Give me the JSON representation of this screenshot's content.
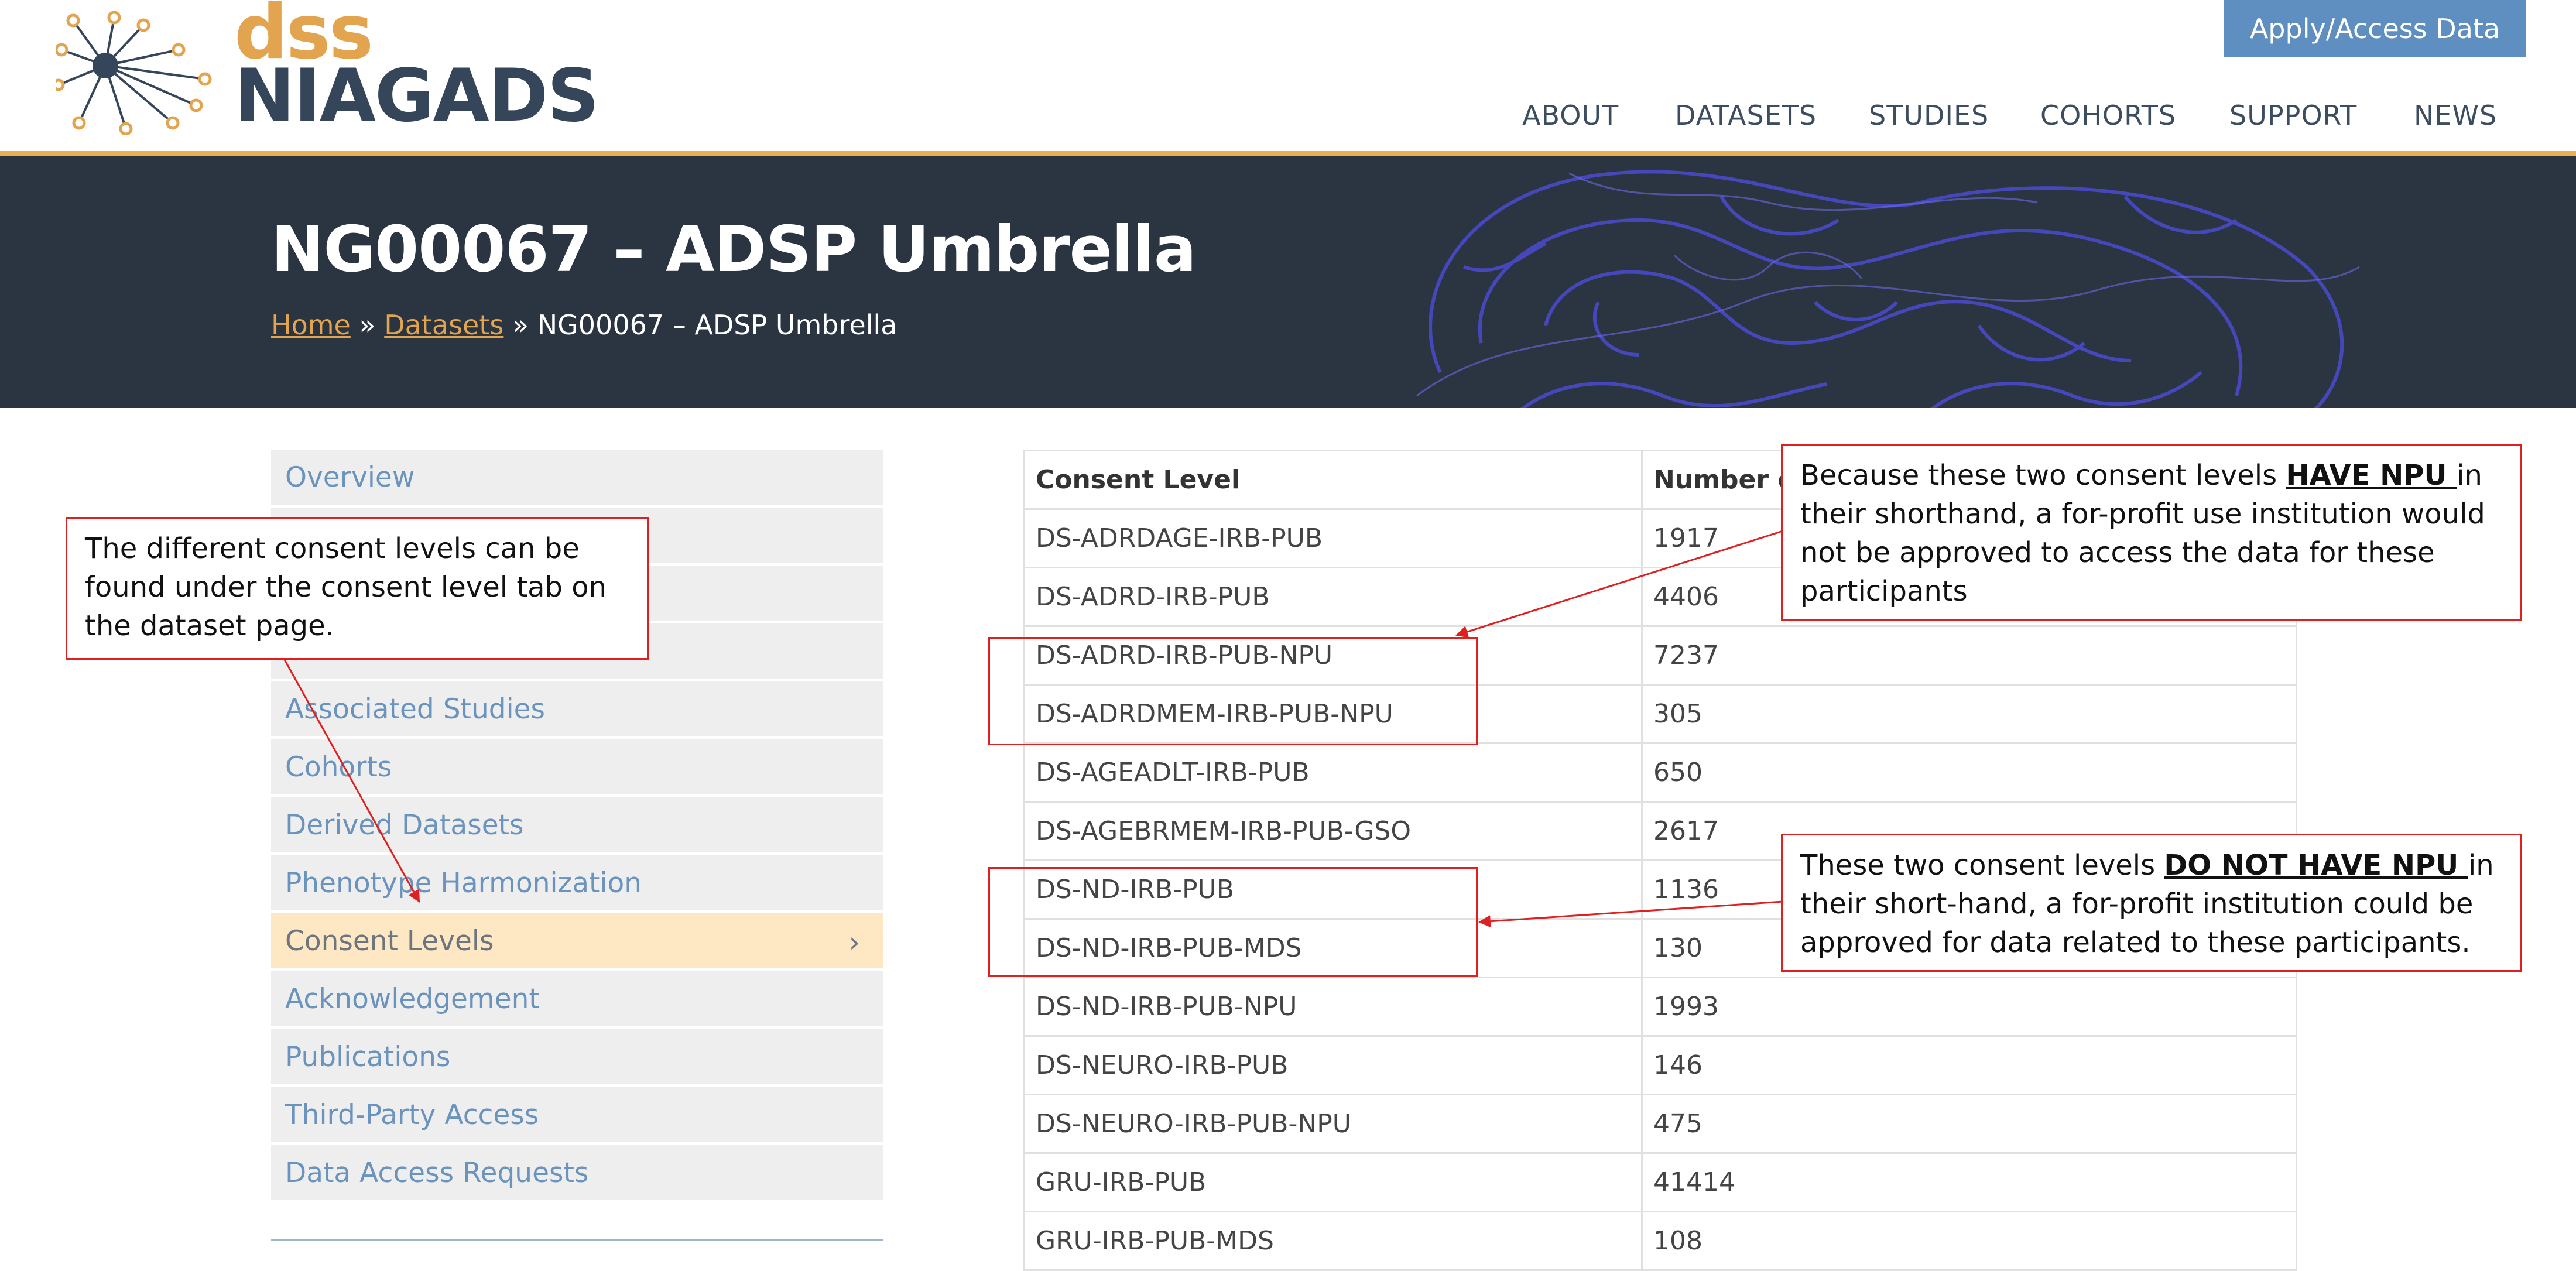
{
  "header": {
    "logo_dss": "dss",
    "logo_niagads": "NIAGADS",
    "apply_button": "Apply/Access Data",
    "nav": [
      "ABOUT",
      "DATASETS",
      "STUDIES",
      "COHORTS",
      "SUPPORT",
      "NEWS"
    ]
  },
  "banner": {
    "title": "NG00067 – ADSP Umbrella",
    "breadcrumb": {
      "home": "Home",
      "sep": " » ",
      "datasets": "Datasets",
      "current": "NG00067 – ADSP Umbrella"
    }
  },
  "sidebar": {
    "items": [
      {
        "label": "Overview",
        "active": false
      },
      {
        "label": "",
        "active": false
      },
      {
        "label": "",
        "active": false
      },
      {
        "label": "",
        "active": false
      },
      {
        "label": "Associated Studies",
        "active": false
      },
      {
        "label": "Cohorts",
        "active": false
      },
      {
        "label": "Derived Datasets",
        "active": false
      },
      {
        "label": "Phenotype Harmonization",
        "active": false
      },
      {
        "label": "Consent Levels",
        "active": true
      },
      {
        "label": "Acknowledgement",
        "active": false
      },
      {
        "label": "Publications",
        "active": false
      },
      {
        "label": "Third-Party Access",
        "active": false
      },
      {
        "label": "Data Access Requests",
        "active": false
      }
    ],
    "active_chevron": "›"
  },
  "table": {
    "headers": [
      "Consent Level",
      "Number of"
    ],
    "rows": [
      [
        "DS-ADRDAGE-IRB-PUB",
        "1917"
      ],
      [
        "DS-ADRD-IRB-PUB",
        "4406"
      ],
      [
        "DS-ADRD-IRB-PUB-NPU",
        "7237"
      ],
      [
        "DS-ADRDMEM-IRB-PUB-NPU",
        "305"
      ],
      [
        "DS-AGEADLT-IRB-PUB",
        "650"
      ],
      [
        "DS-AGEBRMEM-IRB-PUB-GSO",
        "2617"
      ],
      [
        "DS-ND-IRB-PUB",
        "1136"
      ],
      [
        "DS-ND-IRB-PUB-MDS",
        "130"
      ],
      [
        "DS-ND-IRB-PUB-NPU",
        "1993"
      ],
      [
        "DS-NEURO-IRB-PUB",
        "146"
      ],
      [
        "DS-NEURO-IRB-PUB-NPU",
        "475"
      ],
      [
        "GRU-IRB-PUB",
        "41414"
      ],
      [
        "GRU-IRB-PUB-MDS",
        "108"
      ]
    ]
  },
  "annotations": {
    "left": "The different consent levels can be found under the consent level tab on the dataset page.",
    "top_right": {
      "pre": "Because these two consent levels ",
      "strong": "HAVE NPU ",
      "post": "in their shorthand, a for-profit use institution would not be approved to access the data for these participants"
    },
    "bottom_right": {
      "pre": "These two consent levels ",
      "strong": "DO NOT HAVE NPU ",
      "post": "in their short-hand, a for-profit institution could be approved for data related to these participants."
    }
  },
  "colors": {
    "accent_gold": "#e3a44f",
    "navy": "#36465a",
    "banner_bg": "#2b3542",
    "apply_blue": "#5e8fc0",
    "link_blue": "#6a93bd",
    "active_bg": "#fde8c3",
    "annotation_red": "#e02020"
  }
}
